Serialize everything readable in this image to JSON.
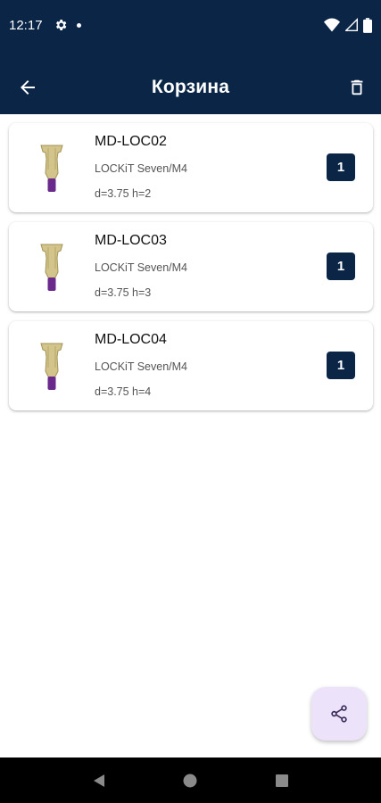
{
  "status_bar": {
    "time": "12:17",
    "icons": [
      "gear-icon",
      "notification-dot-icon",
      "wifi-icon",
      "signal-icon",
      "battery-icon"
    ]
  },
  "app_bar": {
    "title": "Корзина",
    "back_icon": "arrow-back-icon",
    "delete_icon": "trash-icon",
    "background": "#0b2547"
  },
  "cart": {
    "items": [
      {
        "code": "MD-LOC02",
        "name": "LOCKiT Seven/M4",
        "params": "d=3.75 h=2",
        "qty": "1"
      },
      {
        "code": "MD-LOC03",
        "name": "LOCKiT Seven/M4",
        "params": "d=3.75 h=3",
        "qty": "1"
      },
      {
        "code": "MD-LOC04",
        "name": "LOCKiT Seven/M4",
        "params": "d=3.75 h=4",
        "qty": "1"
      }
    ]
  },
  "fab": {
    "icon": "share-icon",
    "background": "#ece3fb"
  },
  "nav_bar": {
    "buttons": [
      "back-triangle-icon",
      "home-circle-icon",
      "recents-square-icon"
    ]
  },
  "colors": {
    "primary": "#0b2547",
    "accent": "#6a2a8c",
    "implant_gold": "#d2c48a"
  }
}
